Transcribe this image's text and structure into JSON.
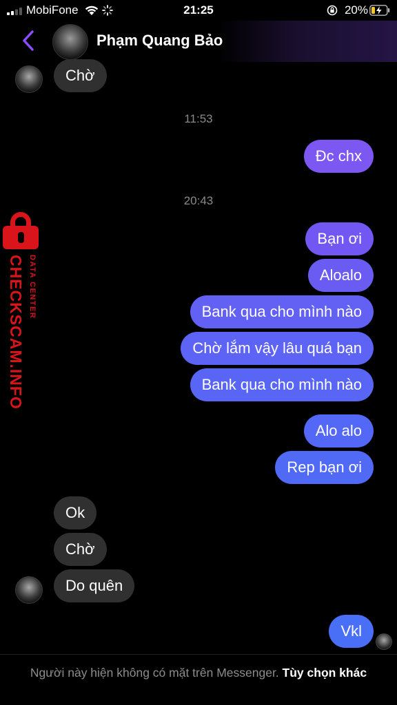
{
  "status_bar": {
    "carrier": "MobiFone",
    "time": "21:25",
    "battery": "20%"
  },
  "header": {
    "contact_name": "Phạm Quang Bảo",
    "back_icon": "chevron-left-icon",
    "accent_color": "#8a4dff"
  },
  "watermark": {
    "brand": "CHECKSCAM.INFO",
    "subtitle": "DATA CENTER",
    "color": "#d9141b"
  },
  "messages": [
    {
      "dir": "in",
      "text": "Chờ"
    },
    {
      "dir": "timestamp",
      "text": "11:53"
    },
    {
      "dir": "out",
      "text": "Đc chx"
    },
    {
      "dir": "timestamp",
      "text": "20:43"
    },
    {
      "dir": "out",
      "text": "Bạn ơi"
    },
    {
      "dir": "out",
      "text": "Aloalo"
    },
    {
      "dir": "out",
      "text": "Bank qua cho mình nào"
    },
    {
      "dir": "out",
      "text": "Chờ lắm vậy lâu quá bạn"
    },
    {
      "dir": "out",
      "text": "Bank qua cho mình nào"
    },
    {
      "dir": "out",
      "text": "Alo alo"
    },
    {
      "dir": "out",
      "text": "Rep bạn ơi"
    },
    {
      "dir": "in",
      "text": "Ok"
    },
    {
      "dir": "in",
      "text": "Chờ"
    },
    {
      "dir": "in",
      "text": "Do quên"
    },
    {
      "dir": "out",
      "text": "Vkl"
    }
  ],
  "colors": {
    "outgoing_top": "#8750f0",
    "outgoing_bottom": "#4f6cf6",
    "incoming": "#303030"
  },
  "footer": {
    "notice": "Người này hiện không có mặt trên Messenger.",
    "link": "Tùy chọn khác"
  }
}
